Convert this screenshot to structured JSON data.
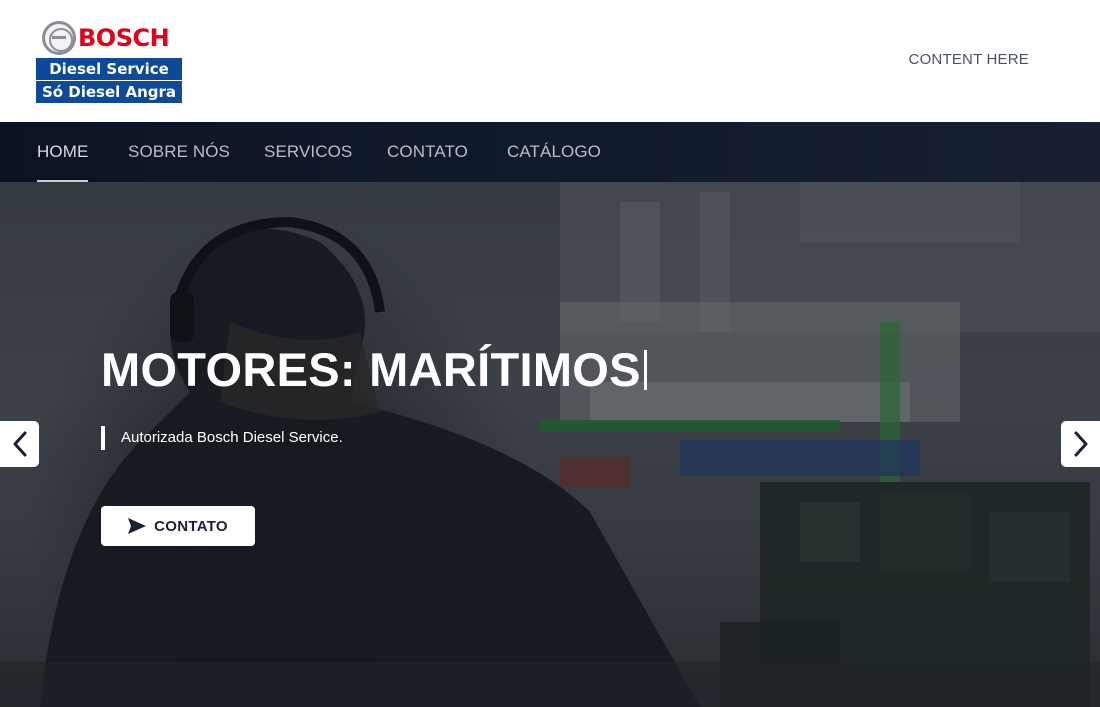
{
  "brand": {
    "logo_word": "BOSCH",
    "logo_line1": "Diesel Service",
    "logo_line2": "Só Diesel Angra",
    "colors": {
      "red": "#e2001a",
      "blue": "#0e4a9a"
    }
  },
  "header": {
    "content_text": "CONTENT HERE"
  },
  "nav": {
    "items": [
      {
        "label": "HOME",
        "active": true
      },
      {
        "label": "SOBRE NÓS",
        "active": false
      },
      {
        "label": "SERVICOS",
        "active": false
      },
      {
        "label": "CONTATO",
        "active": false
      },
      {
        "label": "CATÁLOGO",
        "active": false
      }
    ]
  },
  "hero": {
    "title": "MOTORES: MARÍTIMOS",
    "subtitle": "Autorizada Bosch Diesel Service.",
    "button_label": "CONTATO",
    "button_icon": "send-icon",
    "prev_icon": "chevron-left-icon",
    "next_icon": "chevron-right-icon"
  }
}
